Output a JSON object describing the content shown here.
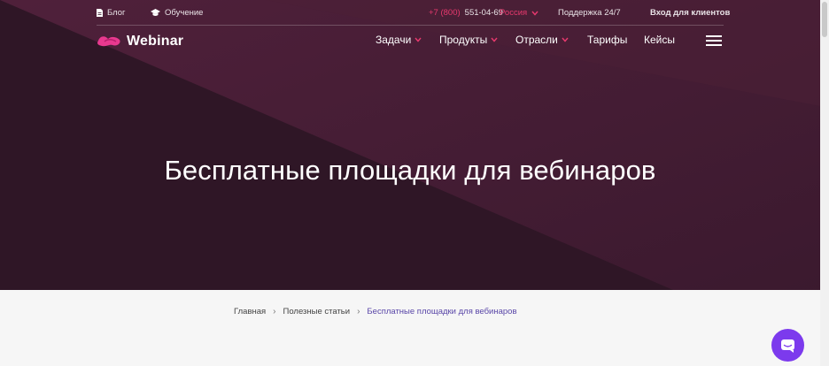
{
  "topbar": {
    "blog": "Блог",
    "learning": "Обучение",
    "phone_prefix": "+7 (800)",
    "phone_number": "551-04-69",
    "region": "Россия",
    "support": "Поддержка 24/7",
    "client_login": "Вход для клиентов"
  },
  "nav": {
    "logo": "Webinar",
    "items": {
      "tasks": "Задачи",
      "products": "Продукты",
      "industries": "Отрасли",
      "pricing": "Тарифы",
      "cases": "Кейсы"
    }
  },
  "hero": {
    "title": "Бесплатные площадки для вебинаров"
  },
  "breadcrumb": {
    "home": "Главная",
    "articles": "Полезные статьи",
    "current": "Бесплатные площадки для вебинаров"
  },
  "colors": {
    "accent": "#e8396e",
    "brand_purple": "#7c3aed",
    "hero_bg": "#3a1a2e",
    "crumb_active": "#5a47a8"
  },
  "icons": {
    "blog": "document-icon",
    "learning": "graduation-cap-icon",
    "menu": "hamburger-icon",
    "chat": "chat-icon"
  }
}
